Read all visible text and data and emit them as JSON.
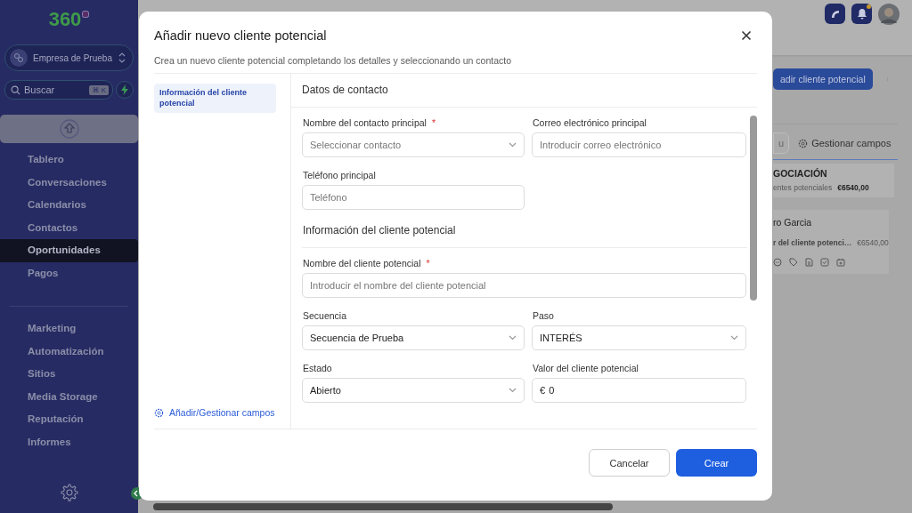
{
  "sidebar": {
    "logo": "360",
    "account": "Empresa de Prueba",
    "search": {
      "placeholder": "Buscar",
      "shortcut": "⌘ K"
    },
    "nav_groups": [
      [
        {
          "label": "Tablero",
          "selected": false
        },
        {
          "label": "Conversaciones",
          "selected": false
        },
        {
          "label": "Calendarios",
          "selected": false
        },
        {
          "label": "Contactos",
          "selected": false
        },
        {
          "label": "Oportunidades",
          "selected": true
        },
        {
          "label": "Pagos",
          "selected": false
        }
      ],
      [
        {
          "label": "Marketing",
          "selected": false
        },
        {
          "label": "Automatización",
          "selected": false
        },
        {
          "label": "Sitios",
          "selected": false
        },
        {
          "label": "Media Storage",
          "selected": false
        },
        {
          "label": "Reputación",
          "selected": false
        },
        {
          "label": "Informes",
          "selected": false
        }
      ]
    ]
  },
  "background": {
    "add_button": "adir cliente potencial",
    "partial_button": "u",
    "manage_fields": "Gestionar campos",
    "stage": {
      "title": "GOCIACIÓN",
      "meta": "entes potenciales",
      "total": "€6540,00"
    },
    "card": {
      "name": "ro Garcia",
      "field": "r del cliente potenci…",
      "value": "€6540,00"
    }
  },
  "modal": {
    "title": "Añadir nuevo cliente potencial",
    "subtitle": "Crea un nuevo cliente potencial completando los detalles y seleccionando un contacto",
    "nav": [
      {
        "label": "Información del cliente potencial",
        "selected": true
      }
    ],
    "manage_link": "Añadir/Gestionar campos",
    "sections": [
      {
        "title": "Datos de contacto",
        "fields": [
          {
            "label": "Nombre del contacto principal",
            "required_mark": "*",
            "kind": "select",
            "placeholder": "Seleccionar contacto"
          },
          {
            "label": "Correo electrónico principal",
            "kind": "input",
            "placeholder": "Introducir correo electrónico"
          },
          {
            "label": "Teléfono principal",
            "kind": "input",
            "placeholder": "Teléfono"
          }
        ]
      },
      {
        "title": "Información del cliente potencial",
        "fields": [
          {
            "label": "Nombre del cliente potencial",
            "required_mark": "*",
            "kind": "longinput",
            "placeholder": "Introducir el nombre del cliente potencial"
          },
          {
            "label": "Secuencia",
            "kind": "select",
            "value": "Secuencia de Prueba"
          },
          {
            "label": "Paso",
            "kind": "select",
            "value": "INTERÉS"
          },
          {
            "label": "Estado",
            "kind": "select",
            "value": "Abierto"
          },
          {
            "label": "Valor del cliente potencial",
            "kind": "input",
            "prefix": "€",
            "value": "0"
          }
        ]
      }
    ],
    "buttons": {
      "cancel": "Cancelar",
      "create": "Crear"
    }
  }
}
